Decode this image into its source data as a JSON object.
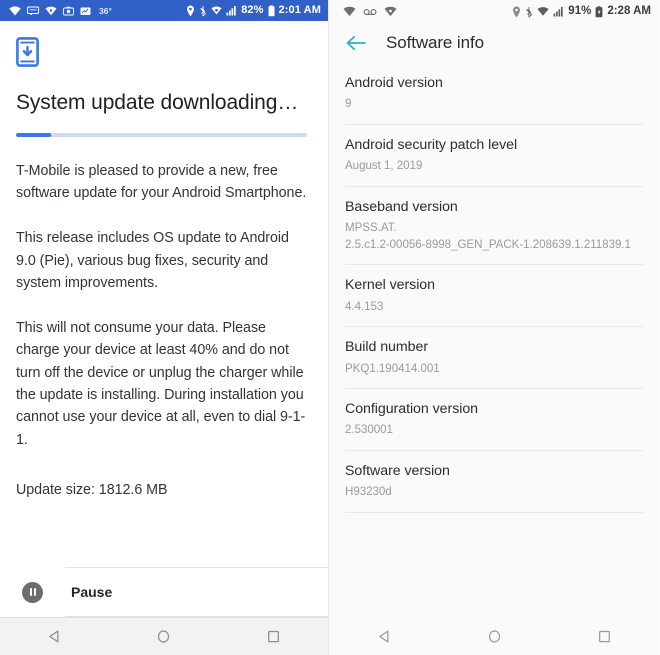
{
  "left_phone": {
    "statusbar": {
      "left_icons": [
        "wifi-icon",
        "sms-icon",
        "vpn-icon",
        "camera-icon",
        "chart-icon"
      ],
      "temperature": "36°",
      "right_icons": [
        "location-icon",
        "bluetooth-icon",
        "vpn-key-icon",
        "signal-icon"
      ],
      "battery_percent": "82%",
      "time": "2:01 AM"
    },
    "update": {
      "icon": "system-update-download-icon",
      "title": "System update downloading…",
      "progress_percent": 12,
      "paragraph_1": "T-Mobile is pleased to provide a new, free software update for your Android Smartphone.",
      "paragraph_2": "This release includes OS update to Android 9.0 (Pie), various bug fixes, security and system improvements.",
      "paragraph_3": "This will not consume your data. Please charge your device at least 40% and do not turn off the device or unplug the charger while the update is installing. During installation you cannot use your device at all, even to dial 9-1-1.",
      "update_size": "Update size: 1812.6 MB",
      "pause_label": "Pause"
    },
    "navbar": {
      "back": "back-triangle-icon",
      "home": "home-circle-icon",
      "recents": "recents-square-icon"
    }
  },
  "right_phone": {
    "statusbar": {
      "left_icons": [
        "wifi-icon",
        "voicemail-icon",
        "vpn-icon"
      ],
      "right_icons": [
        "location-icon",
        "bluetooth-icon",
        "wifi-icon",
        "signal-icon"
      ],
      "battery_percent": "91%",
      "time": "2:28 AM"
    },
    "appbar": {
      "back_icon": "back-arrow-icon",
      "title": "Software info",
      "accent_color": "#26b2c4"
    },
    "info_items": [
      {
        "label": "Android version",
        "value": "9"
      },
      {
        "label": "Android security patch level",
        "value": "August 1, 2019"
      },
      {
        "label": "Baseband version",
        "value": "MPSS.AT.\n2.5.c1.2-00056-8998_GEN_PACK-1.208639.1.211839.1"
      },
      {
        "label": "Kernel version",
        "value": "4.4.153"
      },
      {
        "label": "Build number",
        "value": "PKQ1.190414.001"
      },
      {
        "label": "Configuration version",
        "value": "2.530001"
      },
      {
        "label": "Software version",
        "value": "H93230d"
      }
    ],
    "navbar": {
      "back": "back-triangle-icon",
      "home": "home-circle-icon",
      "recents": "recents-square-icon"
    }
  },
  "colors": {
    "left_statusbar": "#3061c9",
    "progress_accent": "#3b78e7",
    "right_accent": "#26b2c4"
  }
}
